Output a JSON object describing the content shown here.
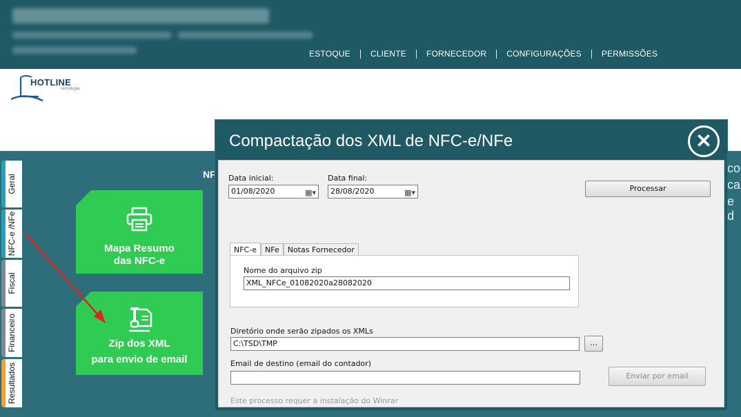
{
  "nav": {
    "items": [
      "ESTOQUE",
      "CLIENTE",
      "FORNECEDOR",
      "CONFIGURAÇÕES",
      "PERMISSÕES"
    ]
  },
  "logo": {
    "text": "HOTLINE",
    "sub": "tecnologia"
  },
  "side_tabs": [
    {
      "label": "Geral",
      "color": "#2b9fb6"
    },
    {
      "label": "NFC-e /NFe",
      "color": "#2b9fb6"
    },
    {
      "label": "Fiscal",
      "color": "#7c8a96"
    },
    {
      "label": "Financeiro",
      "color": "#7c8a96"
    },
    {
      "label": "Resultados",
      "color": "#f2a033"
    }
  ],
  "tiles": {
    "mapa": {
      "line1": "Mapa Resumo",
      "line2": "das NFC-e"
    },
    "zip": {
      "line1": "Zip dos XML",
      "line2": "para envio de email"
    }
  },
  "background": {
    "nf_partial": "NF",
    "right_texts": [
      "co",
      "ca",
      "e d"
    ]
  },
  "modal": {
    "title": "Compactação dos XML de NFC-e/NFe",
    "close_glyph": "✕",
    "data_inicial_label": "Data inicial:",
    "data_inicial_value": "01/08/2020",
    "data_final_label": "Data final:",
    "data_final_value": "28/08/2020",
    "processar_label": "Processar",
    "tabs": [
      "NFC-e",
      "NFe",
      "Notas Fornecedor"
    ],
    "zip_name_label": "Nome do arquivo zip",
    "zip_name_value": "XML_NFCe_01082020a28082020",
    "dir_label": "Diretório onde serão zipados os XMLs",
    "dir_value": "C:\\TSD\\TMP",
    "browse_label": "...",
    "email_label": "Email de destino (email do contador)",
    "email_value": "",
    "send_label": "Enviar por email",
    "footer_note": "Este processo requer a instalação do Winrar"
  },
  "colors": {
    "header": "#1f5964",
    "tile_green": "#2fcb52",
    "arrow": "#e0211d"
  }
}
